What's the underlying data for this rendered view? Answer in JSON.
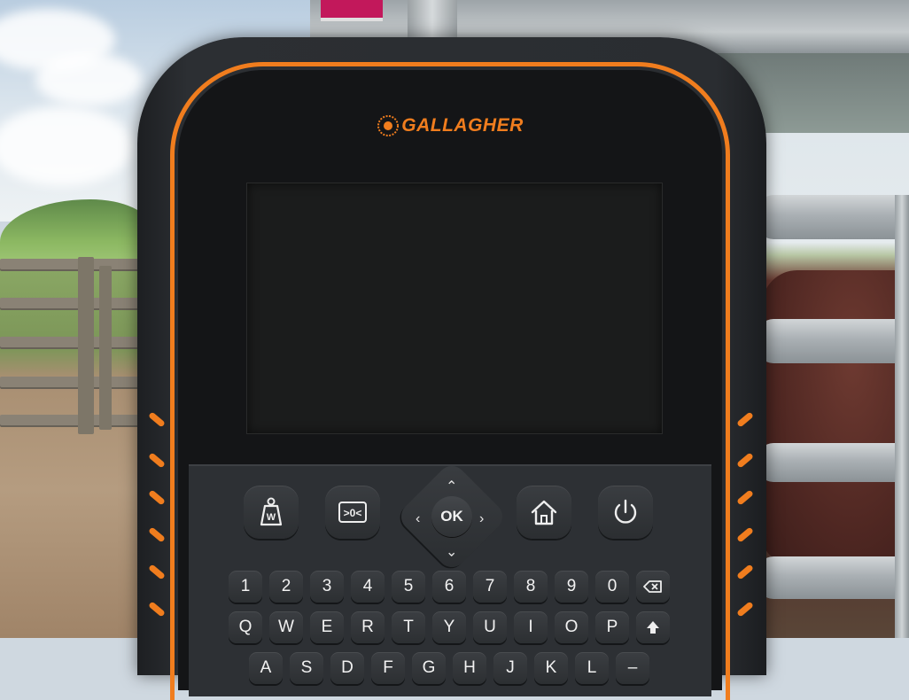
{
  "device": {
    "brand": "GALLAGHER",
    "screen_state": "off"
  },
  "function_keys": [
    {
      "id": "weigh",
      "icon": "weight-icon",
      "label": "W"
    },
    {
      "id": "zero",
      "icon": "zero-icon",
      "label": ">0<"
    },
    {
      "id": "home",
      "icon": "home-icon",
      "label": ""
    },
    {
      "id": "power",
      "icon": "power-icon",
      "label": ""
    }
  ],
  "dpad": {
    "center_label": "OK",
    "arrows": [
      "up",
      "down",
      "left",
      "right"
    ]
  },
  "keyboard": {
    "row1": [
      "1",
      "2",
      "3",
      "4",
      "5",
      "6",
      "7",
      "8",
      "9",
      "0"
    ],
    "row1_extra": "backspace-icon",
    "row2": [
      "Q",
      "W",
      "E",
      "R",
      "T",
      "Y",
      "U",
      "I",
      "O",
      "P"
    ],
    "row2_extra": "shift-icon",
    "row3": [
      "A",
      "S",
      "D",
      "F",
      "G",
      "H",
      "J",
      "K",
      "L",
      "–"
    ]
  },
  "colors": {
    "accent": "#f07d1e",
    "body": "#2a2d31",
    "screen": "#1b1c1c"
  }
}
